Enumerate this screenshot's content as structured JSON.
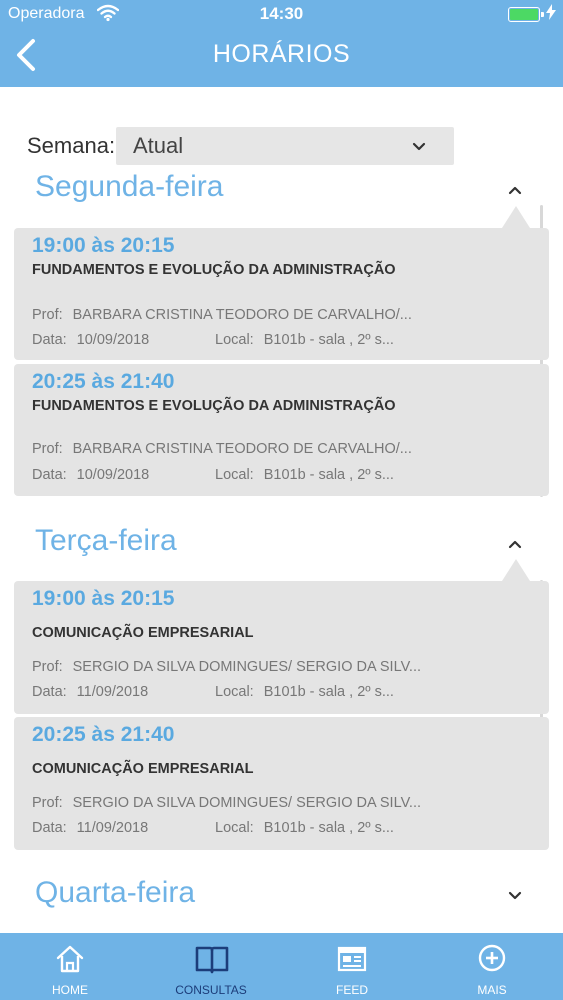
{
  "status_bar": {
    "carrier": "Operadora",
    "time": "14:30"
  },
  "header": {
    "title": "HORÁRIOS"
  },
  "filter": {
    "label": "Semana:",
    "value": "Atual"
  },
  "days": [
    {
      "name": "Segunda-feira",
      "classes": [
        {
          "time": "19:00 às 20:15",
          "subject": "FUNDAMENTOS E EVOLUÇÃO DA ADMINISTRAÇÃO",
          "prof_label": "Prof:",
          "prof": "BARBARA CRISTINA TEODORO DE CARVALHO/...",
          "data_label": "Data:",
          "date": "10/09/2018",
          "local_label": "Local:",
          "local": "B101b - sala , 2º s..."
        },
        {
          "time": "20:25 às 21:40",
          "subject": "FUNDAMENTOS E EVOLUÇÃO DA ADMINISTRAÇÃO",
          "prof_label": "Prof:",
          "prof": "BARBARA CRISTINA TEODORO DE CARVALHO/...",
          "data_label": "Data:",
          "date": "10/09/2018",
          "local_label": "Local:",
          "local": "B101b - sala , 2º s..."
        }
      ]
    },
    {
      "name": "Terça-feira",
      "classes": [
        {
          "time": "19:00 às 20:15",
          "subject": "COMUNICAÇÃO EMPRESARIAL",
          "prof_label": "Prof:",
          "prof": "SERGIO DA SILVA DOMINGUES/ SERGIO DA SILV...",
          "data_label": "Data:",
          "date": "11/09/2018",
          "local_label": "Local:",
          "local": "B101b - sala , 2º s..."
        },
        {
          "time": "20:25 às 21:40",
          "subject": "COMUNICAÇÃO EMPRESARIAL",
          "prof_label": "Prof:",
          "prof": "SERGIO DA SILVA DOMINGUES/ SERGIO DA SILV...",
          "data_label": "Data:",
          "date": "11/09/2018",
          "local_label": "Local:",
          "local": "B101b - sala , 2º s..."
        }
      ]
    },
    {
      "name": "Quarta-feira",
      "classes": []
    }
  ],
  "tabbar": {
    "items": [
      {
        "label": "HOME",
        "icon": "home-icon"
      },
      {
        "label": "CONSULTAS",
        "icon": "book-icon",
        "active": true
      },
      {
        "label": "FEED",
        "icon": "feed-icon"
      },
      {
        "label": "MAIS",
        "icon": "plus-circle-icon"
      }
    ]
  },
  "colors": {
    "primary": "#6fb3e6",
    "active_tab": "#1c3d7a",
    "card_bg": "#e4e4e4",
    "battery": "#4cd964"
  }
}
